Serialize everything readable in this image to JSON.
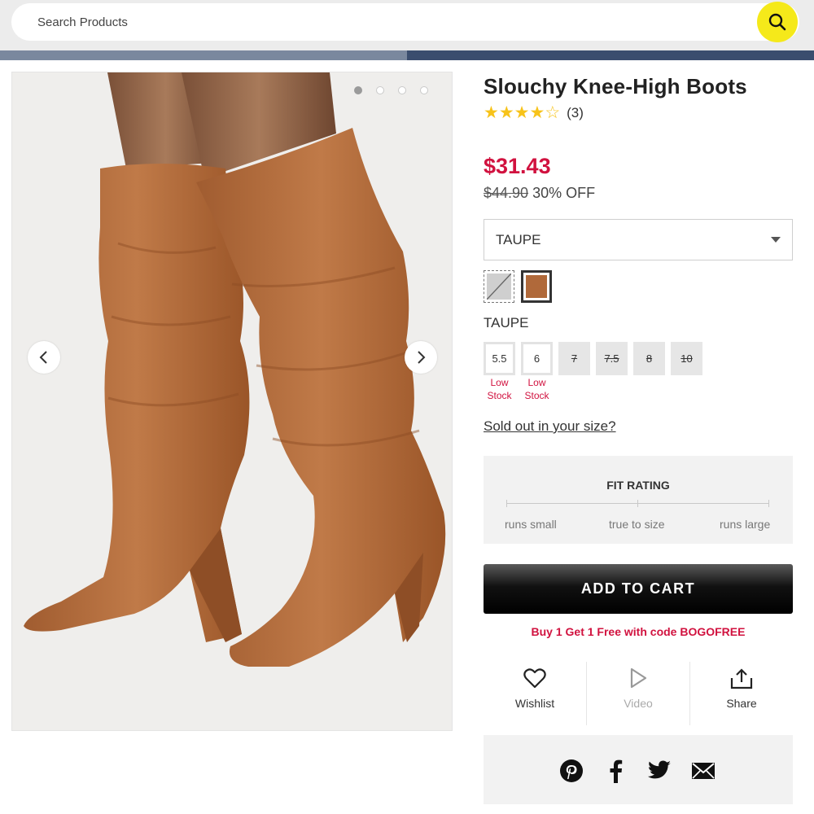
{
  "search": {
    "placeholder": "Search Products"
  },
  "gallery": {
    "image_count": 4,
    "active_index": 0
  },
  "product": {
    "title": "Slouchy Knee-High Boots",
    "rating": 4,
    "rating_max": 5,
    "review_count": "(3)",
    "sale_price": "$31.43",
    "original_price": "$44.90",
    "discount": "30% OFF"
  },
  "color_select": {
    "value": "TAUPE"
  },
  "swatches": [
    {
      "name": "gray",
      "color": "#cfcfcf",
      "available": false
    },
    {
      "name": "taupe",
      "color": "#b0693a",
      "selected": true
    }
  ],
  "selected_color": "TAUPE",
  "sizes": [
    {
      "label": "5.5",
      "available": true,
      "stock": [
        "Low",
        "Stock"
      ]
    },
    {
      "label": "6",
      "available": true,
      "stock": [
        "Low",
        "Stock"
      ]
    },
    {
      "label": "7",
      "available": false
    },
    {
      "label": "7.5",
      "available": false
    },
    {
      "label": "8",
      "available": false
    },
    {
      "label": "10",
      "available": false
    }
  ],
  "sold_out_link": "Sold out in your size?",
  "fit": {
    "title": "FIT RATING",
    "labels": [
      "runs small",
      "true to size",
      "runs large"
    ]
  },
  "cart": {
    "button": "ADD TO CART",
    "promo": "Buy 1 Get 1 Free with code BOGOFREE"
  },
  "actions": [
    {
      "label": "Wishlist",
      "icon": "heart-icon"
    },
    {
      "label": "Video",
      "icon": "play-icon"
    },
    {
      "label": "Share",
      "icon": "share-icon"
    }
  ],
  "social": [
    "pinterest-icon",
    "facebook-icon",
    "twitter-icon",
    "email-icon"
  ],
  "colors": {
    "accent": "#d1123f",
    "search_button": "#f5e91a",
    "star": "#f7c31a"
  }
}
